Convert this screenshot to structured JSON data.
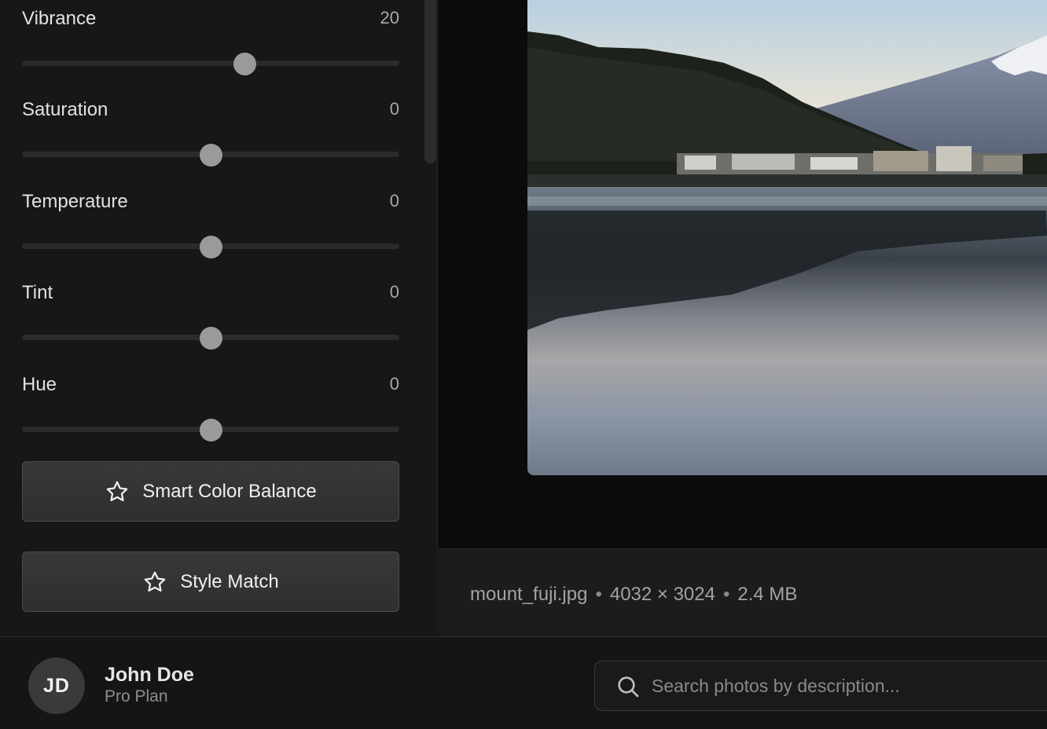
{
  "adjustments": {
    "sliders": [
      {
        "label": "Vibrance",
        "value": "20",
        "position": 0.59
      },
      {
        "label": "Saturation",
        "value": "0",
        "position": 0.5
      },
      {
        "label": "Temperature",
        "value": "0",
        "position": 0.5
      },
      {
        "label": "Tint",
        "value": "0",
        "position": 0.5
      },
      {
        "label": "Hue",
        "value": "0",
        "position": 0.5
      }
    ],
    "buttons": {
      "smart_color_balance": "Smart Color Balance",
      "style_match": "Style Match"
    }
  },
  "image_info": {
    "filename": "mount_fuji.jpg",
    "dimensions": "4032 × 3024",
    "size": "2.4 MB",
    "separator": "•"
  },
  "user": {
    "initials": "JD",
    "name": "John Doe",
    "plan": "Pro Plan"
  },
  "search": {
    "placeholder": "Search photos by description..."
  },
  "colors": {
    "panel_bg": "#171717",
    "button_bg": "#333333",
    "slider_thumb": "#9a9a9a"
  }
}
